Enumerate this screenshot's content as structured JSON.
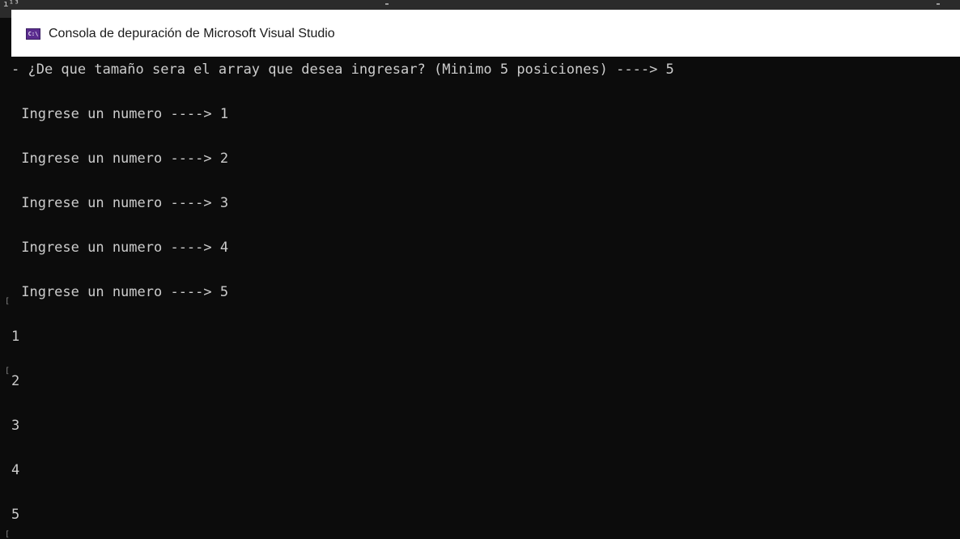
{
  "window": {
    "title": "Consola de depuración de Microsoft Visual Studio",
    "icon": "console-app-icon",
    "icon_glyph": "C:\\"
  },
  "background_glyph": "ı¹³",
  "console": {
    "prompt_line": "- ¿De que tamaño sera el array que desea ingresar? (Minimo 5 posiciones) ----> 5",
    "input_lines": [
      " Ingrese un numero ----> 1",
      " Ingrese un numero ----> 2",
      " Ingrese un numero ----> 3",
      " Ingrese un numero ----> 4",
      " Ingrese un numero ----> 5"
    ],
    "output_lines": [
      "1",
      "2",
      "3",
      "4",
      "5"
    ],
    "edge_marks": [
      "[",
      "[",
      "["
    ]
  },
  "colors": {
    "console_background": "#0c0c0c",
    "console_text": "#cccccc",
    "title_bar": "#ffffff",
    "icon_accent": "#5b2c8f"
  }
}
